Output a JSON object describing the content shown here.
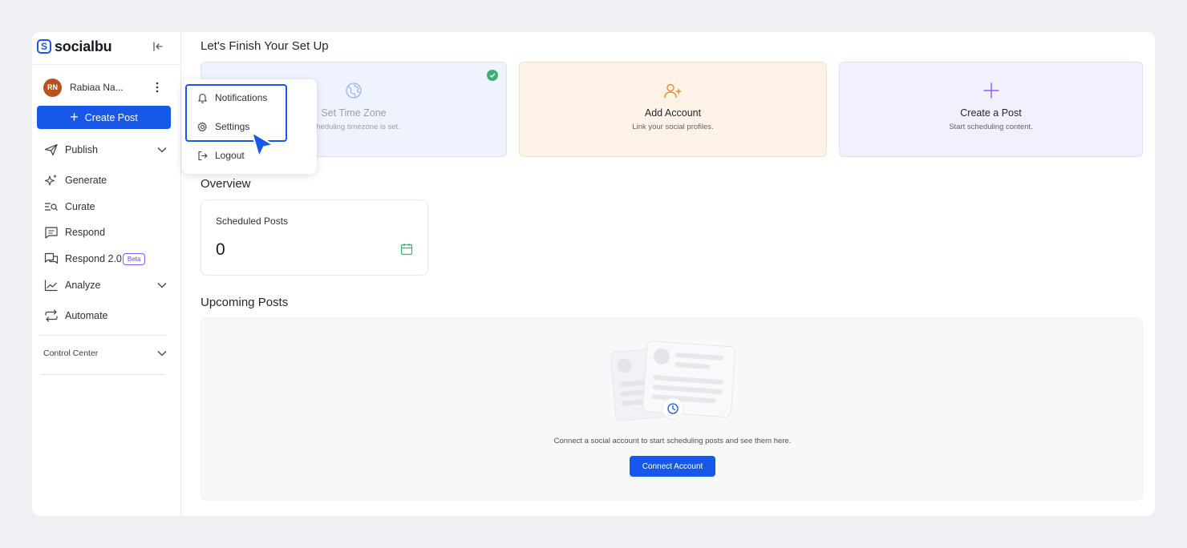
{
  "brand": {
    "logo_letter": "S",
    "name": "socialbu"
  },
  "user": {
    "initials": "RN",
    "name": "Rabiaa Na..."
  },
  "sidebar": {
    "create_post_label": "Create Post",
    "items": [
      {
        "label": "Publish",
        "icon": "send-icon",
        "has_chevron": true
      },
      {
        "label": "Generate",
        "icon": "sparkle-icon"
      },
      {
        "label": "Curate",
        "icon": "curate-search-icon"
      },
      {
        "label": "Respond",
        "icon": "message-icon"
      },
      {
        "label": "Respond 2.0",
        "icon": "messages-icon",
        "badge": "Beta"
      },
      {
        "label": "Analyze",
        "icon": "chart-line-icon",
        "has_chevron": true
      },
      {
        "label": "Automate",
        "icon": "repeat-icon"
      }
    ],
    "control_center_label": "Control Center"
  },
  "dropdown": {
    "items": [
      {
        "label": "Notifications",
        "icon": "bell-icon"
      },
      {
        "label": "Settings",
        "icon": "gear-icon"
      },
      {
        "label": "Logout",
        "icon": "logout-icon"
      }
    ]
  },
  "setup": {
    "title": "Let's Finish Your Set Up",
    "cards": [
      {
        "title": "Set Time Zone",
        "subtitle": "Scheduling timezone is set.",
        "icon": "globe-icon",
        "completed": true
      },
      {
        "title": "Add Account",
        "subtitle": "Link your social profiles.",
        "icon": "user-plus-icon"
      },
      {
        "title": "Create a Post",
        "subtitle": "Start scheduling content.",
        "icon": "plus-icon"
      }
    ]
  },
  "overview": {
    "title": "Overview",
    "stat_label": "Scheduled Posts",
    "stat_value": "0"
  },
  "upcoming": {
    "title": "Upcoming Posts",
    "empty_text": "Connect a social account to start scheduling posts and see them here.",
    "connect_button": "Connect Account"
  },
  "colors": {
    "accent": "#1758e8",
    "avatar": "#b85320",
    "success": "#3bb273",
    "beta": "#7c3aed",
    "add_account_icon": "#f08a24",
    "create_post_icon": "#8b5cf6"
  }
}
